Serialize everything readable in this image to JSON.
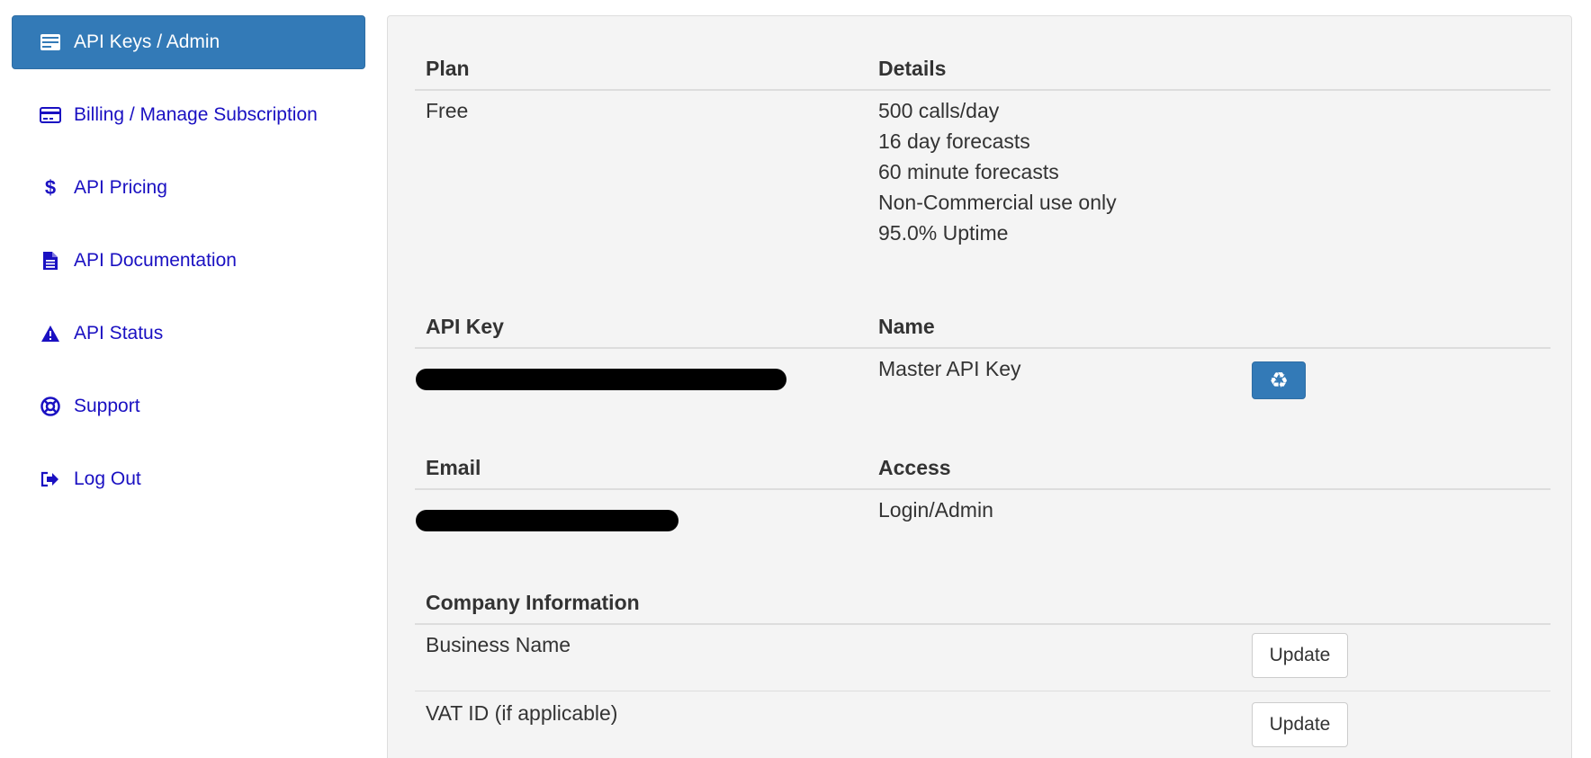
{
  "sidebar": {
    "items": [
      {
        "label": "API Keys / Admin",
        "icon": "keys-list-icon",
        "active": true
      },
      {
        "label": "Billing / Manage Subscription",
        "icon": "credit-card-icon",
        "active": false
      },
      {
        "label": "API Pricing",
        "icon": "dollar-icon",
        "active": false
      },
      {
        "label": "API Documentation",
        "icon": "document-icon",
        "active": false
      },
      {
        "label": "API Status",
        "icon": "warning-icon",
        "active": false
      },
      {
        "label": "Support",
        "icon": "lifebuoy-icon",
        "active": false
      },
      {
        "label": "Log Out",
        "icon": "logout-icon",
        "active": false
      }
    ]
  },
  "plan_section": {
    "header_plan": "Plan",
    "header_details": "Details",
    "plan_value": "Free",
    "details": [
      "500 calls/day",
      "16 day forecasts",
      "60 minute forecasts",
      "Non-Commercial use only",
      "95.0% Uptime"
    ]
  },
  "api_key_section": {
    "header_key": "API Key",
    "header_name": "Name",
    "key_name": "Master API Key",
    "regenerate_icon": "recycle-icon"
  },
  "email_section": {
    "header_email": "Email",
    "header_access": "Access",
    "access_value": "Login/Admin"
  },
  "company_section": {
    "header": "Company Information",
    "rows": [
      {
        "label": "Business Name",
        "button": "Update"
      },
      {
        "label": "VAT ID (if applicable)",
        "button": "Update"
      }
    ]
  },
  "colors": {
    "accent": "#337ab7",
    "link": "#1a10c2",
    "panel_bg": "#f4f4f4"
  }
}
